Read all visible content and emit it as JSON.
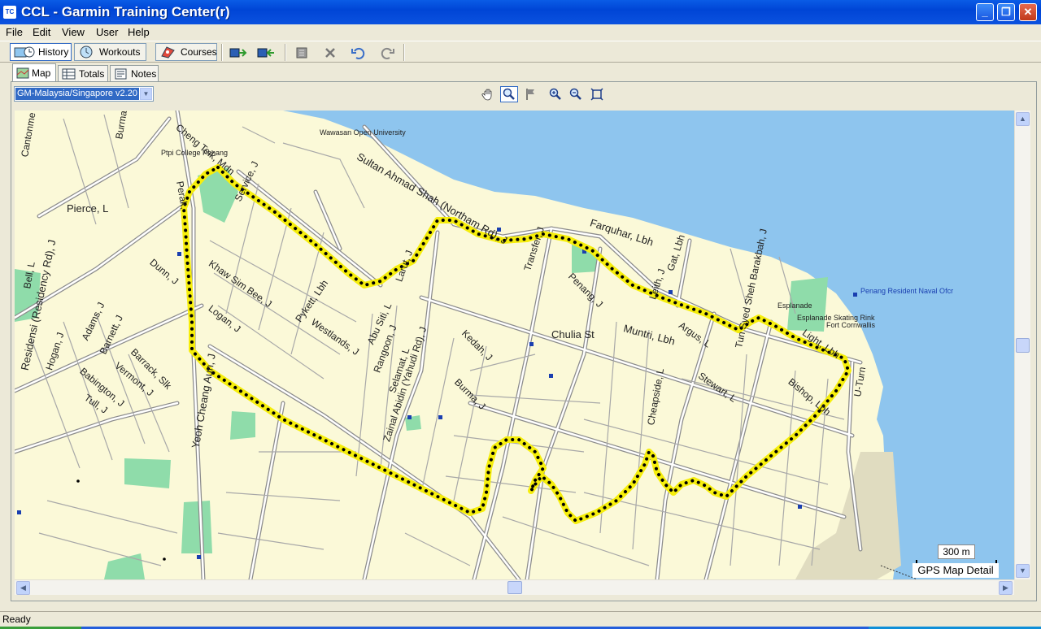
{
  "window": {
    "title": "CCL - Garmin Training Center(r)",
    "app_icon": "TC",
    "buttons": {
      "minimize": "_",
      "maximize": "❐",
      "close": "✕"
    }
  },
  "menu": [
    "File",
    "Edit",
    "View",
    "User",
    "Help"
  ],
  "toolbar": {
    "history": "History",
    "workouts": "Workouts",
    "courses": "Courses",
    "icons": [
      "send-to-device-icon",
      "receive-from-device-icon",
      "import-icon",
      "delete-icon",
      "undo-icon",
      "redo-icon"
    ]
  },
  "subtabs": [
    "Map",
    "Totals",
    "Notes"
  ],
  "map": {
    "selector": "GM-Malaysia/Singapore v2.20",
    "tools": [
      "pan-hand-icon",
      "zoom-tool-icon",
      "flag-icon",
      "zoom-in-icon",
      "zoom-out-icon",
      "fit-extent-icon"
    ],
    "scale": "300 m",
    "detail": "GPS Map Detail",
    "colors": {
      "land": "#fbf9d8",
      "sea": "#8ec5ee",
      "park": "#8fdcaa",
      "route": "#f6ee0c",
      "road": "#7a7a7a"
    },
    "labels": {
      "wawasan": "Wawasan Open University",
      "ptpi": "Ptpi College Penang",
      "cheng_teik": "Cheng Teik, Mdn",
      "cantonment": "Cantonme",
      "burma_top": "Burma",
      "sultan": "Sultan Ahmad Shah (Northam Rd), J",
      "service": "Service, J",
      "perak": "Perak,",
      "pierce": "Pierce, L",
      "dunn": "Dunn, J",
      "khaw": "Khaw Sim Bee, J",
      "logan": "Logan, J",
      "pykett": "Pykett, Lbh",
      "westlands": "Westlands, J",
      "abu_siti": "Abu Siti, L",
      "larut": "Larut, J",
      "rangoon": "Rangoon, J",
      "selamat": "Selamat, L",
      "zainal": "Zainal Abidin (Yahudi Rd), J",
      "kedah": "Kedah, J",
      "burma": "Burma, J",
      "transfer": "Transfer, J",
      "farquhar": "Farquhar, Lbh",
      "penang": "Penang, J",
      "leith": "Leith, J",
      "gat": "Gat, Lbh",
      "chulia": "Chulia St",
      "muntri": "Muntri, Lbh",
      "argus": "Argus, L",
      "stewart": "Stewart, L",
      "cheapside": "Cheapside, L",
      "tun_syed": "Tun Syed Sheh Barakbah, J",
      "esplanade": "Esplanade",
      "skating": "Esplanade Skating Rink",
      "cornwallis": "Fort Cornwallis",
      "naval": "Penang Resident Naval Ofcr",
      "light": "Light, Lbh",
      "bishop": "Bishop, Lbh",
      "uturn": "U-Turn",
      "bell": "Bell, L",
      "residensi": "Residensi (Residency Rd), J",
      "hogan": "Hogan, J",
      "adams": "Adams, J",
      "barnett": "Barnett, J",
      "barrack": "Barrack, Slk",
      "vermont": "Vermont, J",
      "babington": "Babington, J",
      "tull": "Tull, J",
      "yeoh": "Yeoh Cheang Aun, J"
    }
  },
  "status": "Ready"
}
